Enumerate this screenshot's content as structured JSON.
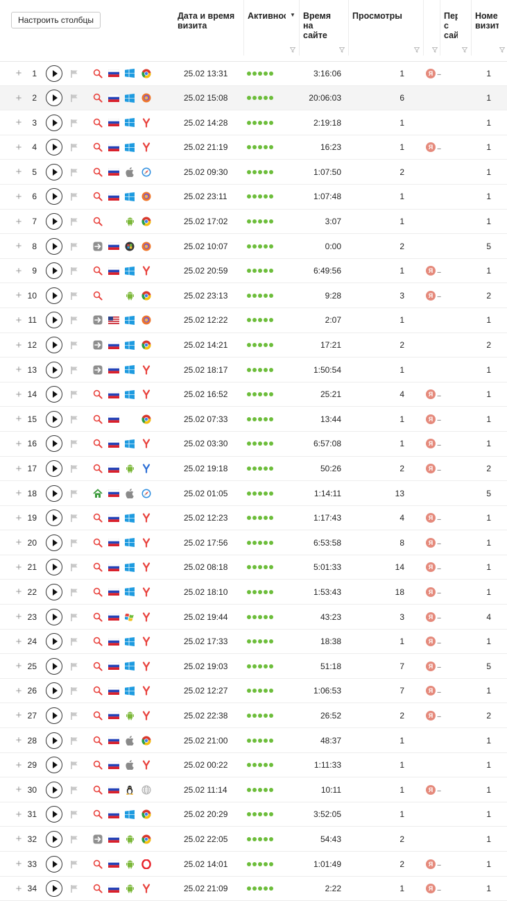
{
  "toolbar": {
    "configure_columns_label": "Настроить столбцы"
  },
  "columns": {
    "datetime": "Дата и время визита",
    "activity": "Активнос",
    "time_on_site": "Время на сайте",
    "views": "Просмотры",
    "ref_narrow": "",
    "first_site": "Пер с сай",
    "visit_number": "Номе визит"
  },
  "colors": {
    "activity_dot": "#6cbd3a",
    "yandex_badge": "#e58a7c",
    "accent_red": "#e8413c"
  },
  "rows": [
    {
      "n": "1",
      "src": "search",
      "flag": "ru",
      "os": "windows",
      "br": "chrome",
      "date": "25.02 13:31",
      "time": "3:16:06",
      "views": "1",
      "ref": true,
      "visit": "1"
    },
    {
      "n": "2",
      "src": "search",
      "flag": "ru",
      "os": "windows",
      "br": "firefox",
      "date": "25.02 15:08",
      "time": "20:06:03",
      "views": "6",
      "ref": false,
      "visit": "1",
      "hl": true
    },
    {
      "n": "3",
      "src": "search",
      "flag": "ru",
      "os": "windows",
      "br": "yandex",
      "date": "25.02 14:28",
      "time": "2:19:18",
      "views": "1",
      "ref": false,
      "visit": "1"
    },
    {
      "n": "4",
      "src": "search",
      "flag": "ru",
      "os": "windows",
      "br": "yandex",
      "date": "25.02 21:19",
      "time": "16:23",
      "views": "1",
      "ref": true,
      "visit": "1"
    },
    {
      "n": "5",
      "src": "search",
      "flag": "ru",
      "os": "apple",
      "br": "safari",
      "date": "25.02 09:30",
      "time": "1:07:50",
      "views": "2",
      "ref": false,
      "visit": "1"
    },
    {
      "n": "6",
      "src": "search",
      "flag": "ru",
      "os": "windows",
      "br": "firefox",
      "date": "25.02 23:11",
      "time": "1:07:48",
      "views": "1",
      "ref": false,
      "visit": "1"
    },
    {
      "n": "7",
      "src": "search",
      "flag": "",
      "os": "android",
      "br": "chrome",
      "date": "25.02 17:02",
      "time": "3:07",
      "views": "1",
      "ref": false,
      "visit": "1"
    },
    {
      "n": "8",
      "src": "direct",
      "flag": "ru",
      "os": "win7",
      "br": "firefox",
      "date": "25.02 10:07",
      "time": "0:00",
      "views": "2",
      "ref": false,
      "visit": "5"
    },
    {
      "n": "9",
      "src": "search",
      "flag": "ru",
      "os": "windows",
      "br": "yandex",
      "date": "25.02 20:59",
      "time": "6:49:56",
      "views": "1",
      "ref": true,
      "visit": "1"
    },
    {
      "n": "10",
      "src": "search",
      "flag": "",
      "os": "android",
      "br": "chrome",
      "date": "25.02 23:13",
      "time": "9:28",
      "views": "3",
      "ref": true,
      "visit": "2"
    },
    {
      "n": "11",
      "src": "direct",
      "flag": "us",
      "os": "windows",
      "br": "firefox",
      "date": "25.02 12:22",
      "time": "2:07",
      "views": "1",
      "ref": false,
      "visit": "1"
    },
    {
      "n": "12",
      "src": "direct",
      "flag": "ru",
      "os": "windows",
      "br": "chrome",
      "date": "25.02 14:21",
      "time": "17:21",
      "views": "2",
      "ref": false,
      "visit": "2"
    },
    {
      "n": "13",
      "src": "direct",
      "flag": "ru",
      "os": "windows",
      "br": "yandex",
      "date": "25.02 18:17",
      "time": "1:50:54",
      "views": "1",
      "ref": false,
      "visit": "1"
    },
    {
      "n": "14",
      "src": "search",
      "flag": "ru",
      "os": "windows",
      "br": "yandex",
      "date": "25.02 16:52",
      "time": "25:21",
      "views": "4",
      "ref": true,
      "visit": "1"
    },
    {
      "n": "15",
      "src": "search",
      "flag": "ru",
      "os": "",
      "br": "chrome",
      "date": "25.02 07:33",
      "time": "13:44",
      "views": "1",
      "ref": true,
      "visit": "1"
    },
    {
      "n": "16",
      "src": "search",
      "flag": "ru",
      "os": "windows",
      "br": "yandex",
      "date": "25.02 03:30",
      "time": "6:57:08",
      "views": "1",
      "ref": true,
      "visit": "1"
    },
    {
      "n": "17",
      "src": "search",
      "flag": "ru",
      "os": "android",
      "br": "yandex-blue",
      "date": "25.02 19:18",
      "time": "50:26",
      "views": "2",
      "ref": true,
      "visit": "2"
    },
    {
      "n": "18",
      "src": "home",
      "flag": "ru",
      "os": "apple",
      "br": "safari",
      "date": "25.02 01:05",
      "time": "1:14:11",
      "views": "13",
      "ref": false,
      "visit": "5"
    },
    {
      "n": "19",
      "src": "search",
      "flag": "ru",
      "os": "windows",
      "br": "yandex",
      "date": "25.02 12:23",
      "time": "1:17:43",
      "views": "4",
      "ref": true,
      "visit": "1"
    },
    {
      "n": "20",
      "src": "search",
      "flag": "ru",
      "os": "windows",
      "br": "yandex",
      "date": "25.02 17:56",
      "time": "6:53:58",
      "views": "8",
      "ref": true,
      "visit": "1"
    },
    {
      "n": "21",
      "src": "search",
      "flag": "ru",
      "os": "windows",
      "br": "yandex",
      "date": "25.02 08:18",
      "time": "5:01:33",
      "views": "14",
      "ref": true,
      "visit": "1"
    },
    {
      "n": "22",
      "src": "search",
      "flag": "ru",
      "os": "windows",
      "br": "yandex",
      "date": "25.02 18:10",
      "time": "1:53:43",
      "views": "18",
      "ref": true,
      "visit": "1"
    },
    {
      "n": "23",
      "src": "search",
      "flag": "ru",
      "os": "winxp",
      "br": "yandex",
      "date": "25.02 19:44",
      "time": "43:23",
      "views": "3",
      "ref": true,
      "visit": "4"
    },
    {
      "n": "24",
      "src": "search",
      "flag": "ru",
      "os": "windows",
      "br": "yandex",
      "date": "25.02 17:33",
      "time": "18:38",
      "views": "1",
      "ref": true,
      "visit": "1"
    },
    {
      "n": "25",
      "src": "search",
      "flag": "ru",
      "os": "windows",
      "br": "yandex",
      "date": "25.02 19:03",
      "time": "51:18",
      "views": "7",
      "ref": true,
      "visit": "5"
    },
    {
      "n": "26",
      "src": "search",
      "flag": "ru",
      "os": "windows",
      "br": "yandex",
      "date": "25.02 12:27",
      "time": "1:06:53",
      "views": "7",
      "ref": true,
      "visit": "1"
    },
    {
      "n": "27",
      "src": "search",
      "flag": "ru",
      "os": "android",
      "br": "yandex",
      "date": "25.02 22:38",
      "time": "26:52",
      "views": "2",
      "ref": true,
      "visit": "2"
    },
    {
      "n": "28",
      "src": "search",
      "flag": "ru",
      "os": "apple",
      "br": "chrome",
      "date": "25.02 21:00",
      "time": "48:37",
      "views": "1",
      "ref": false,
      "visit": "1"
    },
    {
      "n": "29",
      "src": "search",
      "flag": "ru",
      "os": "apple",
      "br": "yandex",
      "date": "25.02 00:22",
      "time": "1:11:33",
      "views": "1",
      "ref": false,
      "visit": "1"
    },
    {
      "n": "30",
      "src": "search",
      "flag": "ru",
      "os": "linux",
      "br": "other",
      "date": "25.02 11:14",
      "time": "10:11",
      "views": "1",
      "ref": true,
      "visit": "1"
    },
    {
      "n": "31",
      "src": "search",
      "flag": "ru",
      "os": "windows",
      "br": "chrome",
      "date": "25.02 20:29",
      "time": "3:52:05",
      "views": "1",
      "ref": false,
      "visit": "1"
    },
    {
      "n": "32",
      "src": "direct",
      "flag": "ru",
      "os": "android",
      "br": "chrome",
      "date": "25.02 22:05",
      "time": "54:43",
      "views": "2",
      "ref": false,
      "visit": "1"
    },
    {
      "n": "33",
      "src": "search",
      "flag": "ru",
      "os": "android",
      "br": "opera",
      "date": "25.02 14:01",
      "time": "1:01:49",
      "views": "2",
      "ref": true,
      "visit": "1"
    },
    {
      "n": "34",
      "src": "search",
      "flag": "ru",
      "os": "android",
      "br": "yandex",
      "date": "25.02 21:09",
      "time": "2:22",
      "views": "1",
      "ref": true,
      "visit": "1"
    }
  ],
  "ref_badge_letter": "Я",
  "ref_ellipsis": "..."
}
